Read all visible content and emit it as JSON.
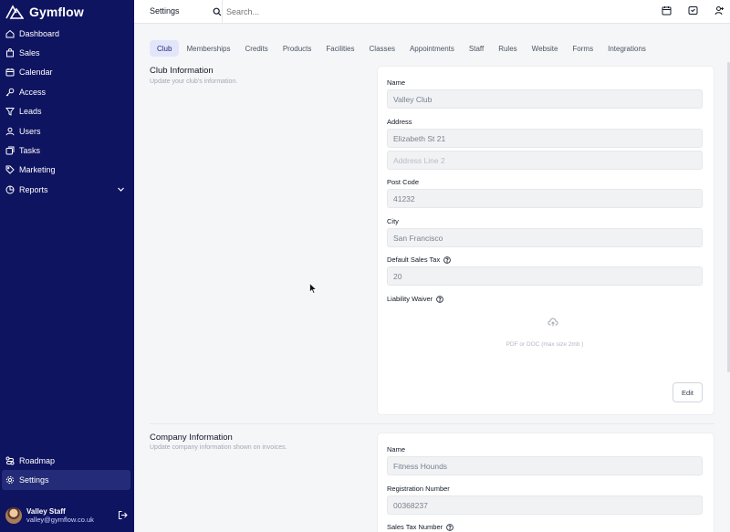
{
  "app": {
    "name": "Gymflow"
  },
  "sidebar": {
    "items": [
      {
        "label": "Dashboard",
        "icon": "home-icon"
      },
      {
        "label": "Sales",
        "icon": "cart-icon"
      },
      {
        "label": "Calendar",
        "icon": "calendar-icon"
      },
      {
        "label": "Access",
        "icon": "key-icon"
      },
      {
        "label": "Leads",
        "icon": "funnel-icon"
      },
      {
        "label": "Users",
        "icon": "users-icon"
      },
      {
        "label": "Tasks",
        "icon": "tasks-icon"
      },
      {
        "label": "Marketing",
        "icon": "tag-icon"
      },
      {
        "label": "Reports",
        "icon": "chart-icon",
        "expandable": true
      }
    ],
    "bottom_items": [
      {
        "label": "Roadmap",
        "icon": "roadmap-icon"
      },
      {
        "label": "Settings",
        "icon": "gear-icon",
        "active": true
      }
    ],
    "user": {
      "name": "Valley Staff",
      "email": "valley@gymflow.co.uk"
    }
  },
  "topbar": {
    "title": "Settings",
    "search_placeholder": "Search..."
  },
  "tabs": [
    {
      "label": "Club",
      "active": true
    },
    {
      "label": "Memberships"
    },
    {
      "label": "Credits"
    },
    {
      "label": "Products"
    },
    {
      "label": "Facilities"
    },
    {
      "label": "Classes"
    },
    {
      "label": "Appointments"
    },
    {
      "label": "Staff"
    },
    {
      "label": "Rules"
    },
    {
      "label": "Website"
    },
    {
      "label": "Forms"
    },
    {
      "label": "Integrations"
    }
  ],
  "club": {
    "title": "Club Information",
    "subtitle": "Update your club's information.",
    "name_label": "Name",
    "name_value": "Valley Club",
    "address_label": "Address",
    "address_line1": "Elizabeth St 21",
    "address_line2_placeholder": "Address Line 2",
    "postcode_label": "Post Code",
    "postcode_value": "41232",
    "city_label": "City",
    "city_value": "San Francisco",
    "tax_label": "Default Sales Tax",
    "tax_value": "20",
    "waiver_label": "Liability Waiver",
    "waiver_hint": "PDF or DOC (max size 2mb )",
    "edit_label": "Edit"
  },
  "company": {
    "title": "Company Information",
    "subtitle": "Update company information shown on invoices.",
    "name_label": "Name",
    "name_value": "Fitness Hounds",
    "reg_label": "Registration Number",
    "reg_value": "00368237",
    "tax_number_label": "Sales Tax Number"
  },
  "colors": {
    "sidebar_bg": "#0f1461",
    "active_tab_bg": "#e3e6fb"
  }
}
